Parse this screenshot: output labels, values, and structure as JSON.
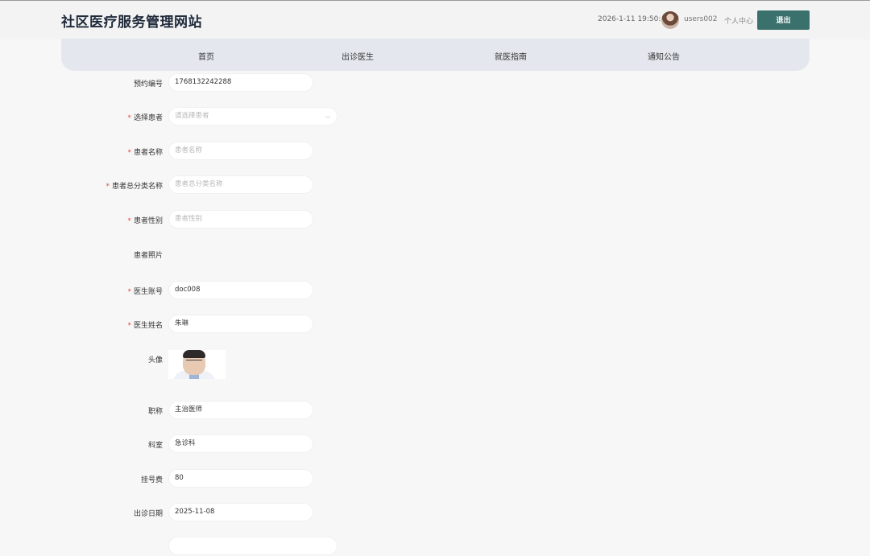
{
  "header": {
    "site_title": "社区医疗服务管理网站",
    "datetime": "2026-1-11 19:50:43",
    "username": "users002",
    "personal_center": "个人中心",
    "logout": "退出"
  },
  "nav": [
    "首页",
    "出诊医生",
    "就医指南",
    "通知公告"
  ],
  "form": {
    "appointment_no": {
      "label": "预约编号",
      "value": "1768132242288",
      "required": false
    },
    "select_patient": {
      "label": "选择患者",
      "placeholder": "请选择患者",
      "required": true
    },
    "patient_name": {
      "label": "患者名称",
      "placeholder": "患者名称",
      "required": true
    },
    "patient_category": {
      "label": "患者总分类名称",
      "placeholder": "患者总分类名称",
      "required": true
    },
    "patient_gender": {
      "label": "患者性别",
      "placeholder": "患者性别",
      "required": true
    },
    "patient_photo": {
      "label": "患者照片"
    },
    "doctor_account": {
      "label": "医生账号",
      "value": "doc008",
      "required": true
    },
    "doctor_name": {
      "label": "医生姓名",
      "value": "朱琳",
      "required": true
    },
    "avatar": {
      "label": "头像"
    },
    "title": {
      "label": "职称",
      "value": "主治医师"
    },
    "department": {
      "label": "科室",
      "value": "急诊科"
    },
    "fee": {
      "label": "挂号费",
      "value": "80"
    },
    "visit_date": {
      "label": "出诊日期",
      "value": "2025-11-08"
    }
  }
}
